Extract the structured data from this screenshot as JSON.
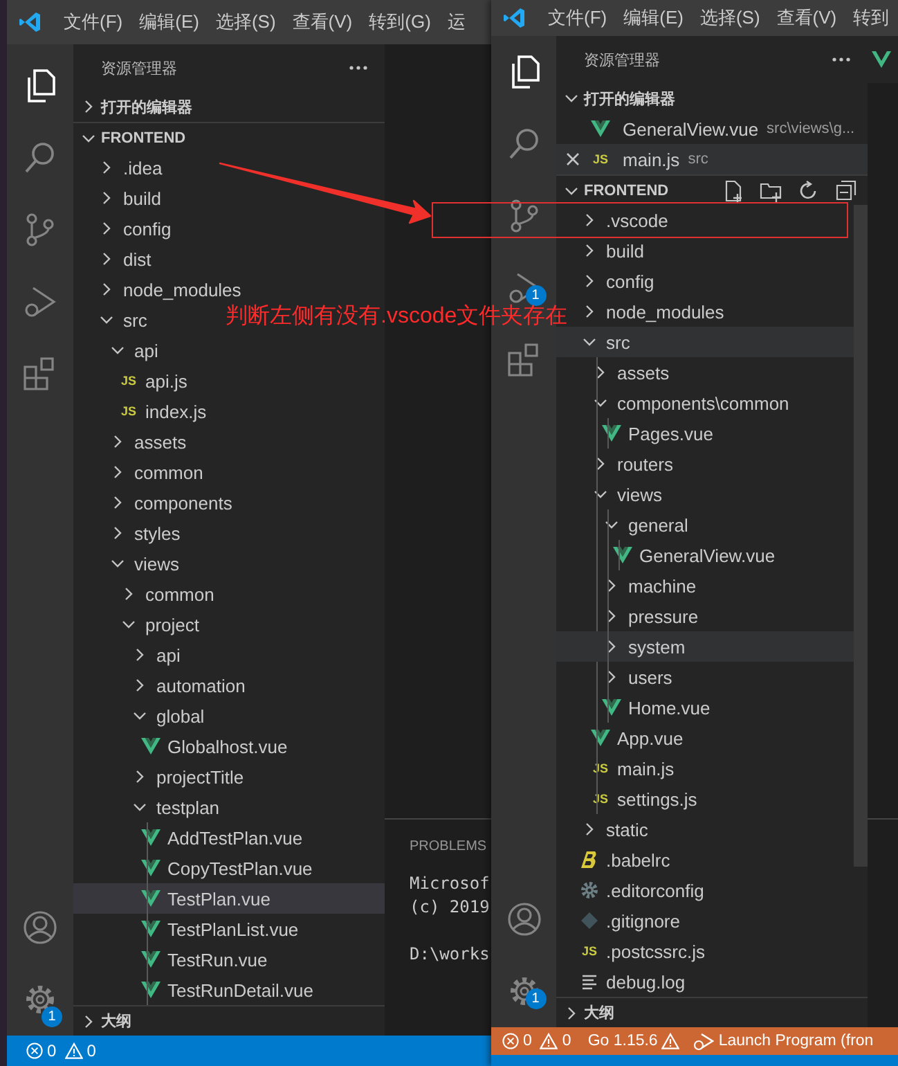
{
  "windows": [
    {
      "menu": [
        "文件(F)",
        "编辑(E)",
        "选择(S)",
        "查看(V)",
        "转到(G)",
        "运"
      ],
      "activity_badges": {
        "settings": "1"
      },
      "explorer_title": "资源管理器",
      "open_editors": {
        "title": "打开的编辑器",
        "expanded": false
      },
      "root": {
        "name": "FRONTEND",
        "expanded": true,
        "children": [
          {
            "name": ".idea",
            "kind": "folder",
            "expanded": false,
            "selected": false
          },
          {
            "name": "build",
            "kind": "folder",
            "expanded": false,
            "selected": false
          },
          {
            "name": "config",
            "kind": "folder",
            "expanded": false,
            "selected": false
          },
          {
            "name": "dist",
            "kind": "folder",
            "expanded": false,
            "selected": false
          },
          {
            "name": "node_modules",
            "kind": "folder",
            "expanded": false,
            "selected": false
          },
          {
            "name": "src",
            "kind": "folder",
            "expanded": true,
            "selected": false,
            "guide": false,
            "children": [
              {
                "name": "api",
                "kind": "folder",
                "expanded": true,
                "selected": false,
                "guide": false,
                "children": [
                  {
                    "name": "api.js",
                    "kind": "js",
                    "icon_text": "JS",
                    "selected": false
                  },
                  {
                    "name": "index.js",
                    "kind": "js",
                    "icon_text": "JS",
                    "selected": false
                  }
                ]
              },
              {
                "name": "assets",
                "kind": "folder",
                "expanded": false,
                "selected": false
              },
              {
                "name": "common",
                "kind": "folder",
                "expanded": false,
                "selected": false
              },
              {
                "name": "components",
                "kind": "folder",
                "expanded": false,
                "selected": false
              },
              {
                "name": "styles",
                "kind": "folder",
                "expanded": false,
                "selected": false
              },
              {
                "name": "views",
                "kind": "folder",
                "expanded": true,
                "selected": false,
                "guide": false,
                "children": [
                  {
                    "name": "common",
                    "kind": "folder",
                    "expanded": false,
                    "selected": false
                  },
                  {
                    "name": "project",
                    "kind": "folder",
                    "expanded": true,
                    "selected": false,
                    "guide": false,
                    "children": [
                      {
                        "name": "api",
                        "kind": "folder",
                        "expanded": false,
                        "selected": false
                      },
                      {
                        "name": "automation",
                        "kind": "folder",
                        "expanded": false,
                        "selected": false
                      },
                      {
                        "name": "global",
                        "kind": "folder",
                        "expanded": true,
                        "selected": false,
                        "guide": false,
                        "children": [
                          {
                            "name": "Globalhost.vue",
                            "kind": "vue",
                            "selected": false
                          }
                        ]
                      },
                      {
                        "name": "projectTitle",
                        "kind": "folder",
                        "expanded": false,
                        "selected": false
                      },
                      {
                        "name": "testplan",
                        "kind": "folder",
                        "expanded": true,
                        "selected": false,
                        "guide": true,
                        "children": [
                          {
                            "name": "AddTestPlan.vue",
                            "kind": "vue",
                            "selected": false
                          },
                          {
                            "name": "CopyTestPlan.vue",
                            "kind": "vue",
                            "selected": false
                          },
                          {
                            "name": "TestPlan.vue",
                            "kind": "vue",
                            "selected": true
                          },
                          {
                            "name": "TestPlanList.vue",
                            "kind": "vue",
                            "selected": false
                          },
                          {
                            "name": "TestRun.vue",
                            "kind": "vue",
                            "selected": false
                          },
                          {
                            "name": "TestRunDetail.vue",
                            "kind": "vue",
                            "selected": false
                          }
                        ]
                      }
                    ]
                  }
                ]
              }
            ]
          }
        ]
      },
      "outline": {
        "title": "大纲",
        "expanded": false
      },
      "panel": {
        "tab": "PROBLEMS",
        "lines": [
          "Microsof",
          "(c) 2019",
          "D:\\works"
        ]
      },
      "status_bar": {
        "debugging": false,
        "errors": "0",
        "warnings": "0"
      }
    },
    {
      "menu": [
        "文件(F)",
        "编辑(E)",
        "选择(S)",
        "查看(V)",
        "转到"
      ],
      "activity_badges": {
        "debug": "1",
        "settings": "1"
      },
      "explorer_title": "资源管理器",
      "open_editors": {
        "title": "打开的编辑器",
        "expanded": true,
        "items": [
          {
            "name": "GeneralView.vue",
            "kind": "vue",
            "description": "src\\views\\g...",
            "selected": false,
            "closable": false
          },
          {
            "name": "main.js",
            "kind": "js",
            "icon_text": "JS",
            "description": "src",
            "selected": true,
            "closable": true
          }
        ]
      },
      "root": {
        "name": "FRONTEND",
        "expanded": true,
        "children": [
          {
            "name": ".vscode",
            "kind": "folder",
            "expanded": false,
            "selected": false
          },
          {
            "name": "build",
            "kind": "folder",
            "expanded": false,
            "selected": false
          },
          {
            "name": "config",
            "kind": "folder",
            "expanded": false,
            "selected": false
          },
          {
            "name": "node_modules",
            "kind": "folder",
            "expanded": false,
            "selected": false
          },
          {
            "name": "src",
            "kind": "folder",
            "expanded": true,
            "selected": true,
            "guide": true,
            "children": [
              {
                "name": "assets",
                "kind": "folder",
                "expanded": false,
                "selected": false
              },
              {
                "name": "components\\common",
                "kind": "folder",
                "expanded": true,
                "selected": false,
                "guide": true,
                "children": [
                  {
                    "name": "Pages.vue",
                    "kind": "vue",
                    "selected": false
                  }
                ]
              },
              {
                "name": "routers",
                "kind": "folder",
                "expanded": false,
                "selected": false
              },
              {
                "name": "views",
                "kind": "folder",
                "expanded": true,
                "selected": false,
                "guide": true,
                "children": [
                  {
                    "name": "general",
                    "kind": "folder",
                    "expanded": true,
                    "selected": false,
                    "guide": true,
                    "children": [
                      {
                        "name": "GeneralView.vue",
                        "kind": "vue",
                        "selected": false
                      }
                    ]
                  },
                  {
                    "name": "machine",
                    "kind": "folder",
                    "expanded": false,
                    "selected": false
                  },
                  {
                    "name": "pressure",
                    "kind": "folder",
                    "expanded": false,
                    "selected": false
                  },
                  {
                    "name": "system",
                    "kind": "folder",
                    "expanded": false,
                    "selected": true
                  },
                  {
                    "name": "users",
                    "kind": "folder",
                    "expanded": false,
                    "selected": false
                  },
                  {
                    "name": "Home.vue",
                    "kind": "vue",
                    "selected": false
                  }
                ]
              },
              {
                "name": "App.vue",
                "kind": "vue",
                "selected": false
              },
              {
                "name": "main.js",
                "kind": "js",
                "icon_text": "JS",
                "selected": false
              },
              {
                "name": "settings.js",
                "kind": "js",
                "icon_text": "JS",
                "selected": false
              }
            ]
          },
          {
            "name": "static",
            "kind": "folder",
            "expanded": false,
            "selected": false
          },
          {
            "name": ".babelrc",
            "kind": "babel",
            "selected": false
          },
          {
            "name": ".editorconfig",
            "kind": "config",
            "selected": false
          },
          {
            "name": ".gitignore",
            "kind": "git",
            "selected": false
          },
          {
            "name": ".postcssrc.js",
            "kind": "js",
            "icon_text": "JS",
            "selected": false
          },
          {
            "name": "debug.log",
            "kind": "log",
            "selected": false
          }
        ]
      },
      "outline": {
        "title": "大纲",
        "expanded": false
      },
      "status_bar": {
        "debugging": true,
        "errors": "0",
        "warnings": "0",
        "items": [
          {
            "kind": "go",
            "text": "Go 1.15.6"
          },
          {
            "kind": "launch",
            "text": "Launch Program (fron"
          }
        ]
      }
    }
  ],
  "annotation": {
    "text": "判断左侧有没有.vscode文件夹存在"
  }
}
